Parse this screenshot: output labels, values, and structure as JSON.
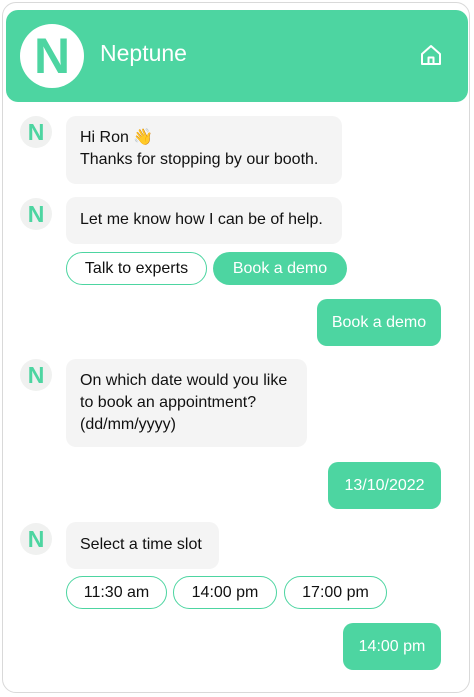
{
  "header": {
    "logo_letter": "N",
    "title": "Neptune",
    "home_icon": "home-icon",
    "color": "#4dd5a1"
  },
  "bot": {
    "avatar_letter": "N"
  },
  "messages": {
    "greeting_line1": "Hi Ron 👋",
    "greeting_line2": "Thanks for stopping by our booth.",
    "help": "Let me know how I can be of help.",
    "date_line1": "On which date would you like",
    "date_line2": "to book an appointment?",
    "date_line3": "(dd/mm/yyyy)",
    "slot": "Select a time slot"
  },
  "quick_replies_1": [
    "Talk to experts",
    "Book a demo"
  ],
  "quick_replies_2": [
    "11:30 am",
    "14:00 pm",
    "17:00 pm"
  ],
  "user_messages": [
    "Book a demo",
    "13/10/2022",
    "14:00 pm"
  ]
}
